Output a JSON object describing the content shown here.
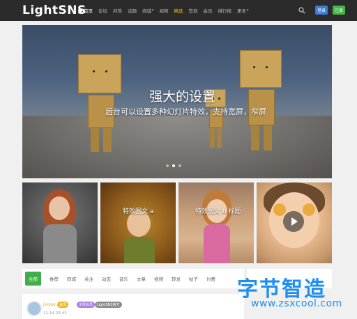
{
  "header": {
    "logo": "LightSNS",
    "nav": [
      {
        "label": "首页",
        "active": true
      },
      {
        "label": "论坛"
      },
      {
        "label": "问答"
      },
      {
        "label": "话题"
      },
      {
        "label": "商城"
      },
      {
        "label": "视频"
      },
      {
        "label": "精选",
        "hot": true
      },
      {
        "label": "签到"
      },
      {
        "label": "会员"
      },
      {
        "label": "排行榜"
      },
      {
        "label": "更多"
      }
    ],
    "login_label": "登录",
    "register_label": "注册"
  },
  "hero": {
    "title": "强大的设置",
    "subtitle": "后台可以设置多种幻灯片特效，支持宽屏，窄屏",
    "slides": 3,
    "active_slide": 2
  },
  "thumbnails": [
    {
      "caption": ""
    },
    {
      "caption": "特效图文 a"
    },
    {
      "caption": "特效图文 b 标题"
    },
    {
      "caption": "",
      "video": true
    }
  ],
  "tabs": [
    "全部",
    "推荐",
    "同城",
    "关注",
    "动态",
    "音乐",
    "文章",
    "视频",
    "转发",
    "帖子",
    "付费"
  ],
  "feed": {
    "username": "jinsoo",
    "badges": [
      "会员",
      "无限会员",
      "LightSNS官方"
    ],
    "time": "11-14 23:43"
  },
  "watermark": {
    "title": "字节智造",
    "url": "www.zsxcool.com"
  },
  "colors": {
    "topbar": "#2b2b2b",
    "login": "#3a7bd5",
    "register": "#44b549",
    "active_tab": "#3fae49",
    "hot_nav": "#f0b323",
    "watermark": "#1f8ef1"
  }
}
